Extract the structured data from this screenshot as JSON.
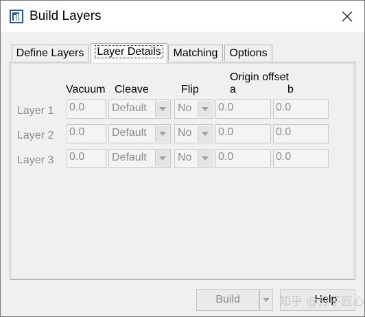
{
  "window": {
    "title": "Build Layers"
  },
  "tabs": [
    {
      "label": "Define Layers",
      "active": false
    },
    {
      "label": "Layer Details",
      "active": true
    },
    {
      "label": "Matching",
      "active": false
    },
    {
      "label": "Options",
      "active": false
    }
  ],
  "headers": {
    "vacuum": "Vacuum",
    "cleave": "Cleave",
    "flip": "Flip",
    "origin_offset": "Origin offset",
    "a": "a",
    "b": "b"
  },
  "layers": [
    {
      "label": "Layer 1",
      "vacuum": "0.0",
      "cleave": "Default",
      "flip": "No",
      "a": "0.0",
      "b": "0.0"
    },
    {
      "label": "Layer 2",
      "vacuum": "0.0",
      "cleave": "Default",
      "flip": "No",
      "a": "0.0",
      "b": "0.0"
    },
    {
      "label": "Layer 3",
      "vacuum": "0.0",
      "cleave": "Default",
      "flip": "No",
      "a": "0.0",
      "b": "0.0"
    }
  ],
  "buttons": {
    "build": "Build",
    "help": "Help"
  },
  "watermark": "知乎 @分子匠心",
  "colors": {
    "disabled_text": "#8c8c8c",
    "titlebar": "#ffffff",
    "dialog_bg": "#f0f0f0"
  },
  "icons": {
    "app": "build-layers-app-icon",
    "close": "close-icon",
    "dropdown": "chevron-down-icon"
  }
}
